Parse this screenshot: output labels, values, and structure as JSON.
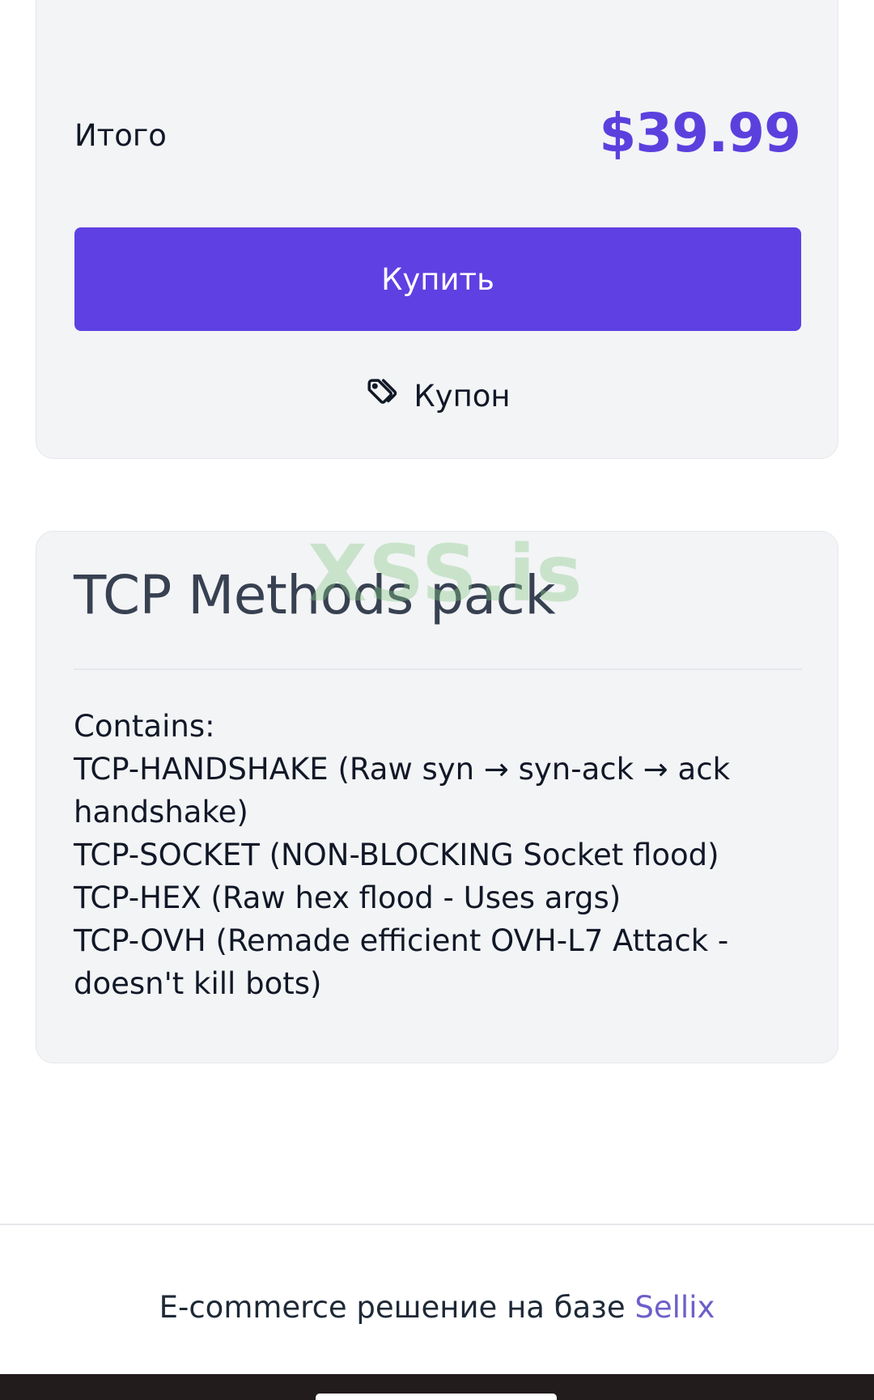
{
  "checkout": {
    "total_label": "Итого",
    "total_price": "$39.99",
    "buy_label": "Купить",
    "coupon_label": "Купон"
  },
  "product": {
    "title": "TCP Methods pack",
    "watermark": "XSS.is",
    "description_lines": [
      "Contains:",
      "TCP-HANDSHAKE (Raw syn → syn-ack → ack handshake)",
      "TCP-SOCKET (NON-BLOCKING Socket flood)",
      "TCP-HEX (Raw hex flood - Uses args)",
      "TCP-OVH (Remade efficient OVH-L7 Attack - doesn't kill bots)"
    ]
  },
  "footer": {
    "text_prefix": "E-commerce решение на базе ",
    "brand_link": "Sellix"
  },
  "colors": {
    "accent": "#5f40e2",
    "price": "#5b40de",
    "card_bg": "#f3f4f6",
    "brand_link": "#6d5fc9"
  },
  "icons": {
    "coupon": "tag-icon"
  }
}
